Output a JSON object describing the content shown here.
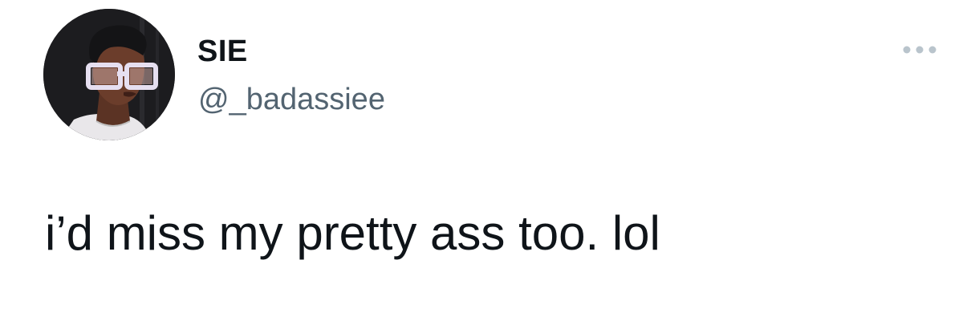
{
  "tweet": {
    "author": {
      "display_name": "SIE",
      "handle": "@_badassiee",
      "avatar_icon": "profile-photo"
    },
    "text": "i’d miss my pretty ass too. lol",
    "menu_icon": "more-options-icon"
  },
  "colors": {
    "text_primary": "#0f1419",
    "text_secondary": "#536471",
    "menu_dots": "#b9c4cc",
    "background": "#ffffff"
  }
}
